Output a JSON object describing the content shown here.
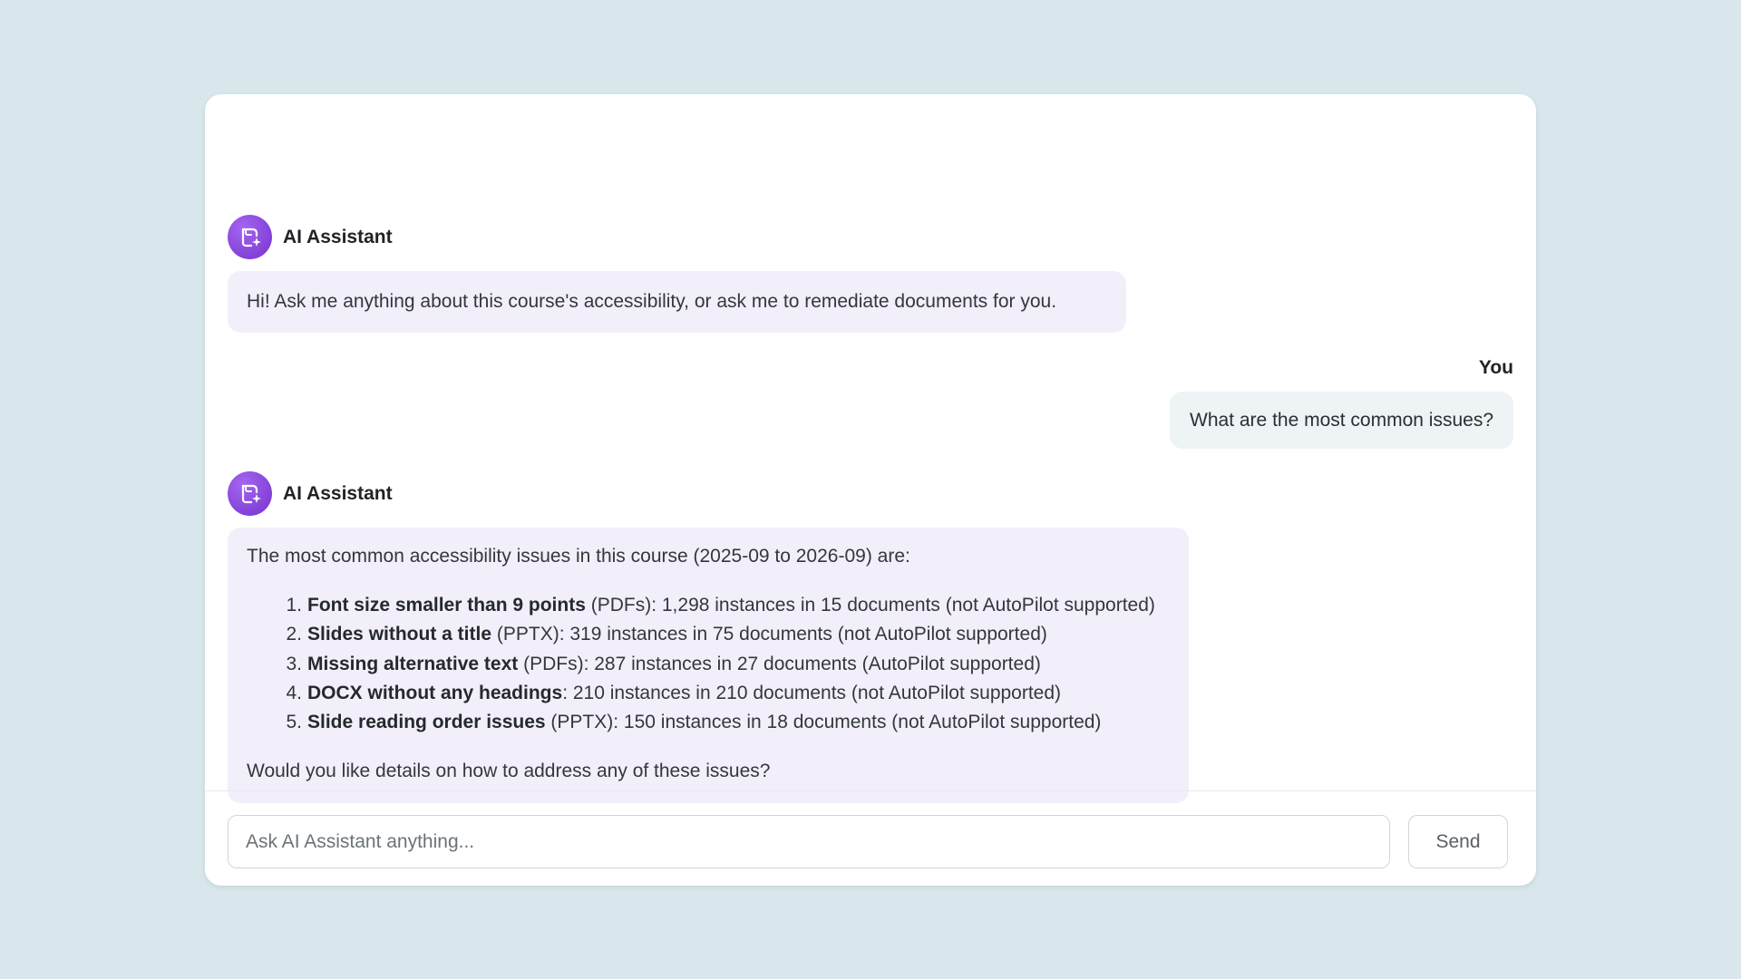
{
  "colors": {
    "background": "#d9e7ec",
    "assistant_bubble": "#f2effb",
    "user_bubble": "#eef3f5",
    "avatar": "#8441d8"
  },
  "messages": [
    {
      "role": "assistant",
      "sender": "AI Assistant",
      "avatar_icon": "ai-assistant-icon",
      "text": "Hi! Ask me anything about this course's accessibility, or ask me to remediate documents for you."
    },
    {
      "role": "user",
      "sender": "You",
      "text": "What are the most common issues?"
    },
    {
      "role": "assistant",
      "sender": "AI Assistant",
      "avatar_icon": "ai-assistant-icon",
      "intro": "The most common accessibility issues in this course (2025-09 to 2026-09) are:",
      "issues": [
        {
          "number": "1.",
          "title": "Font size smaller than 9 points",
          "detail": " (PDFs): 1,298 instances in 15 documents (not AutoPilot supported)"
        },
        {
          "number": "2.",
          "title": "Slides without a title",
          "detail": " (PPTX): 319 instances in 75 documents (not AutoPilot supported)"
        },
        {
          "number": "3.",
          "title": "Missing alternative text",
          "detail": " (PDFs): 287 instances in 27 documents (AutoPilot supported)"
        },
        {
          "number": "4.",
          "title": "DOCX without any headings",
          "detail": ": 210 instances in 210 documents (not AutoPilot supported)"
        },
        {
          "number": "5.",
          "title": "Slide reading order issues",
          "detail": " (PPTX): 150 instances in 18 documents (not AutoPilot supported)"
        }
      ],
      "outro": "Would you like details on how to address any of these issues?"
    }
  ],
  "composer": {
    "placeholder": "Ask AI Assistant anything...",
    "value": "",
    "send_label": "Send"
  }
}
